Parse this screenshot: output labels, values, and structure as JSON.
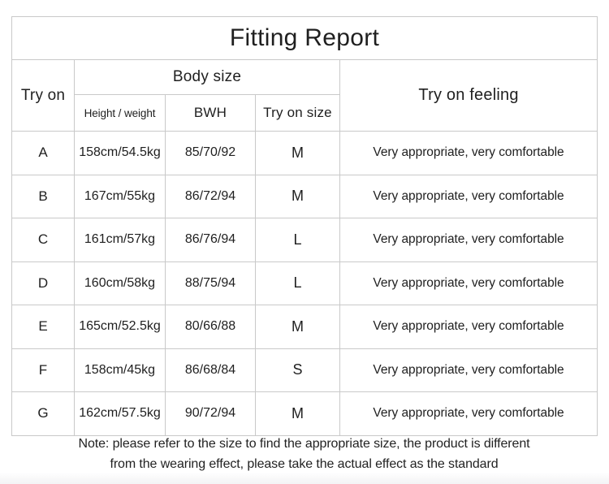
{
  "title": "Fitting Report",
  "table": {
    "headers": {
      "try_on": "Try on",
      "body_size": "Body size",
      "height_weight": "Height / weight",
      "bwh": "BWH",
      "try_on_size": "Try on size",
      "try_on_feeling": "Try on feeling"
    },
    "rows": [
      {
        "code": "A",
        "height_weight": "158cm/54.5kg",
        "bwh": "85/70/92",
        "size": "M",
        "feeling": "Very appropriate, very comfortable"
      },
      {
        "code": "B",
        "height_weight": "167cm/55kg",
        "bwh": "86/72/94",
        "size": "M",
        "feeling": "Very appropriate, very comfortable"
      },
      {
        "code": "C",
        "height_weight": "161cm/57kg",
        "bwh": "86/76/94",
        "size": "L",
        "feeling": "Very appropriate, very comfortable"
      },
      {
        "code": "D",
        "height_weight": "160cm/58kg",
        "bwh": "88/75/94",
        "size": "L",
        "feeling": "Very appropriate, very comfortable"
      },
      {
        "code": "E",
        "height_weight": "165cm/52.5kg",
        "bwh": "80/66/88",
        "size": "M",
        "feeling": "Very appropriate, very comfortable"
      },
      {
        "code": "F",
        "height_weight": "158cm/45kg",
        "bwh": "86/68/84",
        "size": "S",
        "feeling": "Very appropriate, very comfortable"
      },
      {
        "code": "G",
        "height_weight": "162cm/57.5kg",
        "bwh": "90/72/94",
        "size": "M",
        "feeling": "Very appropriate, very comfortable"
      }
    ]
  },
  "note": {
    "line1": "Note: please refer to the size to find the appropriate size, the product is different",
    "line2": "from the wearing effect, please take the actual effect as the standard"
  },
  "colors": {
    "border": "#c9c9c9",
    "text": "#1f1f1f",
    "background": "#ffffff"
  }
}
